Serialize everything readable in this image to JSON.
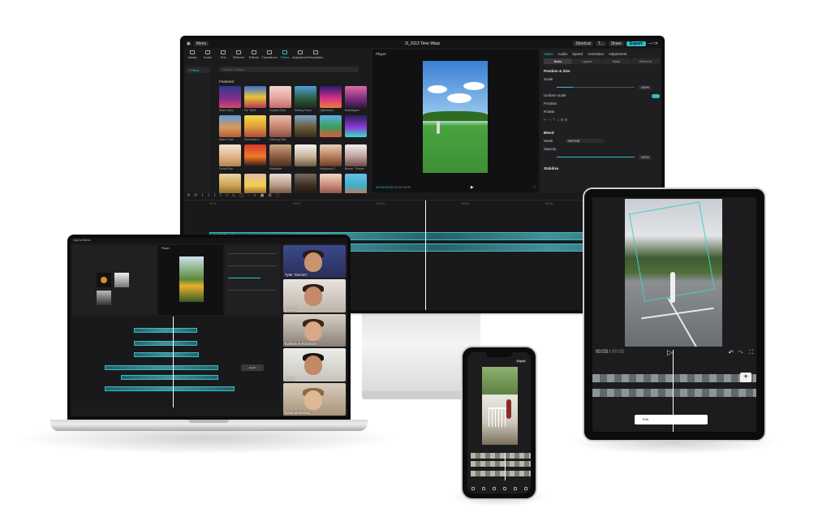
{
  "monitor": {
    "menu_label": "Menu",
    "project_title": "2I_0113 Time Warp",
    "toolbar_right": [
      "Shortcut",
      "T...",
      "Share",
      "Export"
    ],
    "tools": [
      "Media",
      "Audio",
      "Text",
      "Stickers",
      "Effects",
      "Transitions",
      "Filters",
      "Adjustment",
      "Templates"
    ],
    "active_tool": "Filters",
    "nav_item": "• Filters",
    "search_placeholder": "Search in filters",
    "section_label": "Featured",
    "filter_captions": [
      "Rose Hues",
      "Pin Teeth",
      "Crystal Clear",
      "Seeing Trees",
      "Cybernetic",
      "Bubblegum",
      "Warm Gold",
      "Cinematic II",
      "Glowing Skin",
      "",
      "",
      "",
      "Fuzzy Film",
      "",
      "Reflective",
      "",
      "Hollywood 2",
      "Brown - Pokwe"
    ],
    "player_label": "Player",
    "time_current": "00:00:00:00",
    "time_total": "00:00:08:05",
    "props_tabs": [
      "Video",
      "Audio",
      "Speed",
      "Animation",
      "Adjustment"
    ],
    "props_subtabs": [
      "Basic",
      "Layout",
      "Mask",
      "Remove"
    ],
    "props": {
      "position_size": "Position & Size",
      "scale": "Scale",
      "scale_value": "100%",
      "uniform_scale": "Uniform scale",
      "position": "Position",
      "rotate": "Rotate",
      "blend": "Blend",
      "mode": "Mode",
      "mode_value": "Normal",
      "opacity": "Opacity",
      "opacity_value": "100%",
      "stabilize": "Stabilize"
    },
    "ruler_ticks": [
      "00:00",
      "|00:02",
      "|00:04",
      "|00:06",
      "|00:08",
      "|00:10"
    ],
    "clip_label": "2I_0113 Time Warp.mov"
  },
  "laptop": {
    "topbar": "CapCut  Menu",
    "player_label": "Player",
    "dialog_text": "Import",
    "participants": [
      "Tyler Timmich",
      "gradys",
      "Katherine Robinson",
      "Jesus",
      "Katie McKinney"
    ]
  },
  "tablet": {
    "time_current": "00:03",
    "time_total": "00:05",
    "caption_text": "Edit",
    "add_label": "+"
  },
  "phone": {
    "export_label": "Export"
  },
  "colors": {
    "accent": "#29c3c7",
    "background": "#ffffff",
    "panel": "#1b1b1d"
  }
}
